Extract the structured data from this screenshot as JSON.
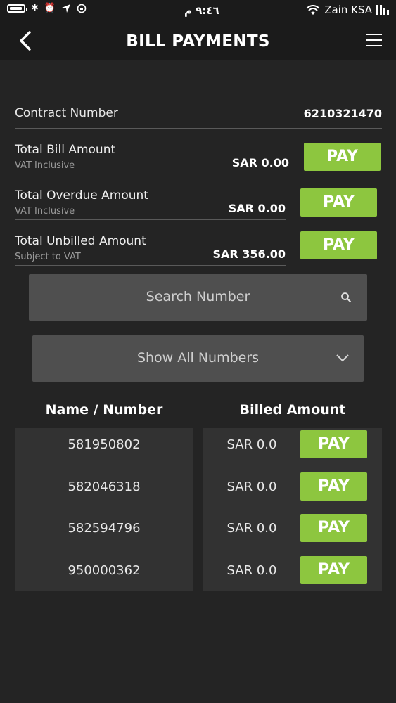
{
  "status_bar": {
    "time": "٩:٤٦ م",
    "carrier": "Zain KSA"
  },
  "header": {
    "title": "BILL PAYMENTS"
  },
  "contract": {
    "label": "Contract Number",
    "value": "6210321470"
  },
  "amounts": [
    {
      "label": "Total Bill Amount",
      "sub": "VAT Inclusive",
      "value": "SAR 0.00",
      "pay_label": "PAY"
    },
    {
      "label": "Total Overdue Amount",
      "sub": "VAT Inclusive",
      "value": "SAR 0.00",
      "pay_label": "PAY"
    },
    {
      "label": "Total Unbilled Amount",
      "sub": "Subject to VAT",
      "value": "SAR 356.00",
      "pay_label": "PAY"
    }
  ],
  "search": {
    "placeholder": "Search Number"
  },
  "filter": {
    "selected": "Show All Numbers"
  },
  "table": {
    "headers": [
      "Name / Number",
      "Billed Amount"
    ],
    "rows": [
      {
        "number": "581950802",
        "amount": "SAR 0.0",
        "pay_label": "PAY"
      },
      {
        "number": "582046318",
        "amount": "SAR 0.0",
        "pay_label": "PAY"
      },
      {
        "number": "582594796",
        "amount": "SAR 0.0",
        "pay_label": "PAY"
      },
      {
        "number": "950000362",
        "amount": "SAR 0.0",
        "pay_label": "PAY"
      }
    ]
  },
  "colors": {
    "accent": "#8dc63f",
    "background": "#242424",
    "panel": "#323232",
    "input": "#4f4f4f"
  }
}
